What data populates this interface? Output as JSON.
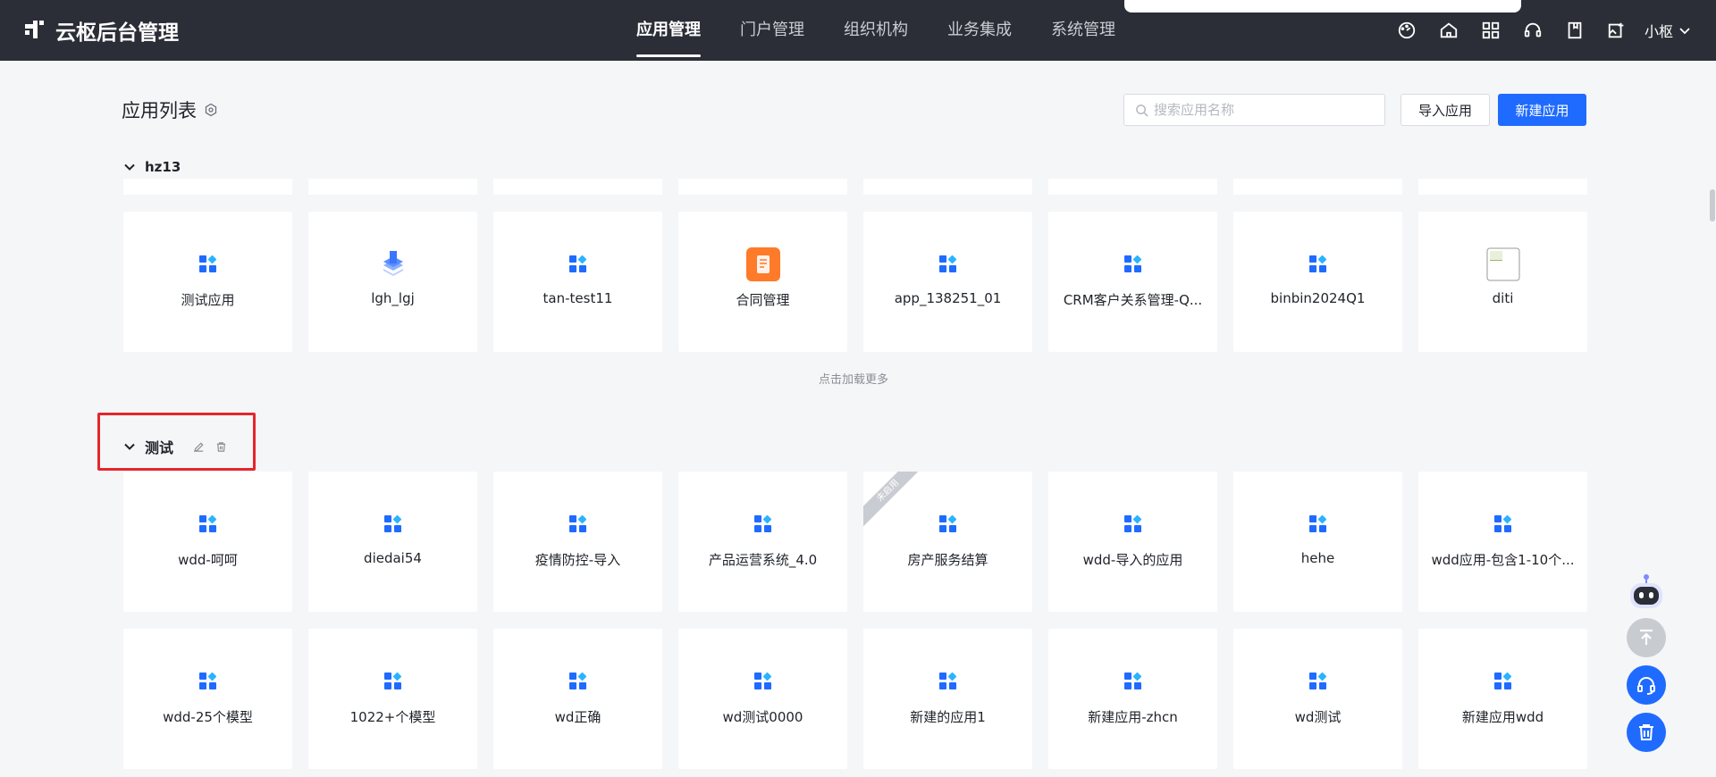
{
  "app": {
    "title": "云枢后台管理"
  },
  "nav": {
    "items": [
      {
        "label": "应用管理",
        "active": true
      },
      {
        "label": "门户管理",
        "active": false
      },
      {
        "label": "组织机构",
        "active": false
      },
      {
        "label": "业务集成",
        "active": false
      },
      {
        "label": "系统管理",
        "active": false
      }
    ]
  },
  "top_icons": [
    "dashboard-icon",
    "home-icon",
    "apps-grid-icon",
    "headset-icon",
    "book-icon",
    "image-export-icon"
  ],
  "user": {
    "name": "小枢"
  },
  "page": {
    "title": "应用列表",
    "search_placeholder": "搜索应用名称",
    "import_label": "导入应用",
    "new_label": "新建应用"
  },
  "groups": [
    {
      "name": "hz13",
      "apps": [
        {
          "name": "测试应用",
          "icon": "grid-blue"
        },
        {
          "name": "lgh_lgj",
          "icon": "layers-blue"
        },
        {
          "name": "tan-test11",
          "icon": "grid-blue"
        },
        {
          "name": "合同管理",
          "icon": "doc-orange"
        },
        {
          "name": "app_138251_01",
          "icon": "grid-blue"
        },
        {
          "name": "CRM客户关系管理-Q...",
          "icon": "grid-blue"
        },
        {
          "name": "binbin2024Q1",
          "icon": "grid-blue"
        },
        {
          "name": "diti",
          "icon": "broken-image"
        }
      ],
      "load_more": "点击加载更多"
    },
    {
      "name": "测试",
      "apps": [
        {
          "name": "wdd-呵呵",
          "icon": "grid-blue"
        },
        {
          "name": "diedai54",
          "icon": "grid-blue"
        },
        {
          "name": "疫情防控-导入",
          "icon": "grid-blue"
        },
        {
          "name": "产品运营系统_4.0",
          "icon": "grid-blue"
        },
        {
          "name": "房产服务结算",
          "icon": "grid-blue",
          "ribbon": "未启用"
        },
        {
          "name": "wdd-导入的应用",
          "icon": "grid-blue"
        },
        {
          "name": "hehe",
          "icon": "grid-blue"
        },
        {
          "name": "wdd应用-包含1-10个...",
          "icon": "grid-blue"
        },
        {
          "name": "wdd-25个模型",
          "icon": "grid-blue"
        },
        {
          "name": "1022+个模型",
          "icon": "grid-blue"
        },
        {
          "name": "wd正确",
          "icon": "grid-blue"
        },
        {
          "name": "wd测试0000",
          "icon": "grid-blue"
        },
        {
          "name": "新建的应用1",
          "icon": "grid-blue"
        },
        {
          "name": "新建应用-zhcn",
          "icon": "grid-blue"
        },
        {
          "name": "wd测试",
          "icon": "grid-blue"
        },
        {
          "name": "新建应用wdd",
          "icon": "grid-blue"
        }
      ]
    }
  ],
  "colors": {
    "topbar": "#2b2e36",
    "primary": "#1f6bff",
    "highlight": "#e5262c"
  }
}
